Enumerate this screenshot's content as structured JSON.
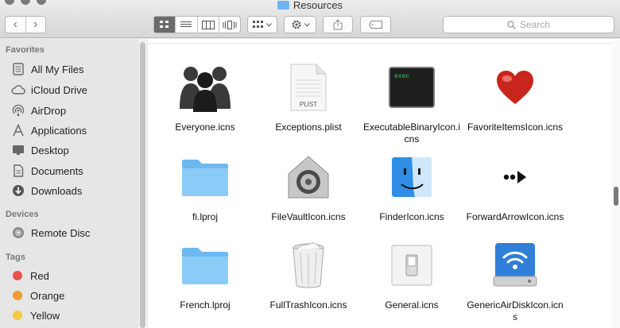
{
  "window": {
    "title": "Resources"
  },
  "toolbar": {
    "back": "‹",
    "forward": "›",
    "search_placeholder": "Search"
  },
  "sidebar": {
    "sections": {
      "favorites": "Favorites",
      "devices": "Devices",
      "tags": "Tags"
    },
    "favorites": [
      {
        "label": "All My Files",
        "icon": "all-files-icon"
      },
      {
        "label": "iCloud Drive",
        "icon": "cloud-icon"
      },
      {
        "label": "AirDrop",
        "icon": "airdrop-icon"
      },
      {
        "label": "Applications",
        "icon": "applications-icon"
      },
      {
        "label": "Desktop",
        "icon": "desktop-icon"
      },
      {
        "label": "Documents",
        "icon": "documents-icon"
      },
      {
        "label": "Downloads",
        "icon": "downloads-icon"
      }
    ],
    "devices": [
      {
        "label": "Remote Disc",
        "icon": "disc-icon"
      }
    ],
    "tags": [
      {
        "label": "Red",
        "color": "#e9514d"
      },
      {
        "label": "Orange",
        "color": "#f19a38"
      },
      {
        "label": "Yellow",
        "color": "#f4c842"
      }
    ]
  },
  "files": [
    {
      "name": "Everyone.icns",
      "icon": "everyone-icon"
    },
    {
      "name": "Exceptions.plist",
      "icon": "plist-file-icon",
      "badge": "PLIST"
    },
    {
      "name": "ExecutableBinaryIcon.icns",
      "icon": "terminal-exec-icon",
      "badge": "exec"
    },
    {
      "name": "FavoriteItemsIcon.icns",
      "icon": "heart-icon"
    },
    {
      "name": "fi.lproj",
      "icon": "folder-icon"
    },
    {
      "name": "FileVaultIcon.icns",
      "icon": "filevault-icon"
    },
    {
      "name": "FinderIcon.icns",
      "icon": "finder-icon"
    },
    {
      "name": "ForwardArrowIcon.icns",
      "icon": "forward-arrow-icon"
    },
    {
      "name": "French.lproj",
      "icon": "folder-icon"
    },
    {
      "name": "FullTrashIcon.icns",
      "icon": "trash-full-icon"
    },
    {
      "name": "General.icns",
      "icon": "general-switch-icon"
    },
    {
      "name": "GenericAirDiskIcon.icns",
      "icon": "air-disk-icon"
    }
  ],
  "colors": {
    "folder": "#7ec4f5",
    "accent": "#3d8ee6",
    "active_view": "#6b6b6b"
  }
}
